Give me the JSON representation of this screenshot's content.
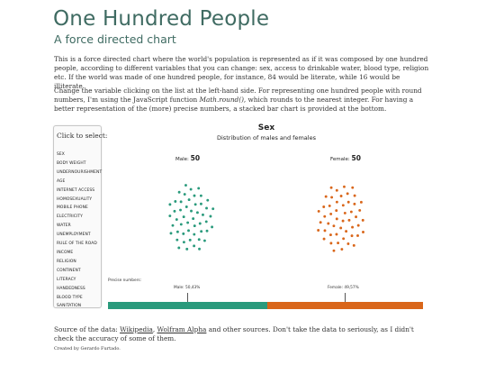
{
  "page": {
    "title": "One Hundred People",
    "subtitle": "A force directed chart",
    "intro_1": "This is a force directed chart where the world's population is represented as if it was composed by one hundred people, according to different variables that you can change: sex, access to drinkable water, blood type, religion etc. If the world was made of one hundred people, for instance, 84 would be literate, while 16 would be illiterate.",
    "intro_2_before": "Change the variable clicking on the list at the left-hand side. For representing one hundred people with round numbers, I'm using the JavaScript function ",
    "intro_2_fn": "Math.round()",
    "intro_2_after": ", which rounds to the nearest integer. For having a better representation of the (more) precise numbers, a stacked bar chart is provided at the bottom."
  },
  "sidebar": {
    "heading": "Click to select:",
    "items": [
      "SEX",
      "BODY WEIGHT",
      "UNDERNOURISHMENT",
      "AGE",
      "INTERNET ACCESS",
      "HOMOSEXUALITY",
      "MOBILE PHONE",
      "ELECTRICITY",
      "WATER",
      "UNEMPLOYMENT",
      "RULE OF THE ROAD",
      "INCOME",
      "RELIGION",
      "CONTINENT",
      "LITERACY",
      "HANDEDNESS",
      "BLOOD TYPE",
      "SANITATION"
    ]
  },
  "colors": {
    "male": "#2a9a7c",
    "female": "#d9661a"
  },
  "chart_data": {
    "type": "force-directed people chart with stacked bar",
    "title": "Sex",
    "subtitle": "Distribution of males and females",
    "groups": [
      {
        "label": "Male:",
        "count": 50,
        "count_text": "50",
        "precise": 50.43,
        "precise_text": "Male: 50,43%",
        "color_key": "male"
      },
      {
        "label": "Female:",
        "count": 50,
        "count_text": "50",
        "precise": 49.57,
        "precise_text": "Female: 49,57%",
        "color_key": "female"
      }
    ],
    "precise_label": "Precise numbers:"
  },
  "footer": {
    "source_before": "Source of the data: ",
    "link_wikipedia": "Wikipedia",
    "source_comma": ", ",
    "link_wolfram": "Wolfram Alpha",
    "source_after": " and other sources. Don't take the data to seriously, as I didn't check the accuracy of some of them.",
    "credit": "Created by Gerardo Furtado."
  }
}
